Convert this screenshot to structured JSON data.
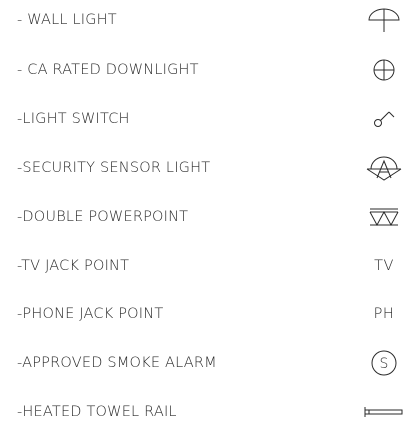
{
  "legend": {
    "items": [
      {
        "label": "- WALL LIGHT",
        "icon": "wall-light-icon"
      },
      {
        "label": "- CA RATED DOWNLIGHT",
        "icon": "downlight-icon"
      },
      {
        "label": "-LIGHT SWITCH",
        "icon": "light-switch-icon"
      },
      {
        "label": "-SECURITY SENSOR LIGHT",
        "icon": "security-sensor-light-icon"
      },
      {
        "label": "-DOUBLE POWERPOINT",
        "icon": "double-powerpoint-icon"
      },
      {
        "label": "-TV JACK POINT",
        "icon": "tv-jack-point",
        "symbol_text": "TV"
      },
      {
        "label": "-PHONE JACK POINT",
        "icon": "phone-jack-point",
        "symbol_text": "PH"
      },
      {
        "label": "-APPROVED SMOKE ALARM",
        "icon": "smoke-alarm-icon",
        "symbol_text": "S"
      },
      {
        "label": "-HEATED TOWEL RAIL",
        "icon": "heated-towel-rail-icon"
      }
    ]
  },
  "colors": {
    "ink": "#2a2a2a",
    "background": "#ffffff"
  }
}
